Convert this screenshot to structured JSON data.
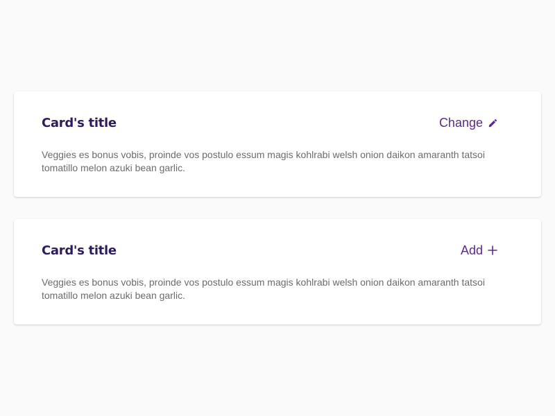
{
  "cards": [
    {
      "title": "Card's title",
      "action_label": "Change",
      "action_icon": "pencil-icon",
      "body": "Veggies es bonus vobis, proinde vos postulo essum magis kohlrabi welsh onion daikon amaranth tatsoi tomatillo melon azuki bean garlic."
    },
    {
      "title": "Card's title",
      "action_label": "Add",
      "action_icon": "plus-icon",
      "body": "Veggies es bonus vobis, proinde vos postulo essum magis kohlrabi welsh onion daikon amaranth tatsoi tomatillo melon azuki bean garlic."
    }
  ],
  "colors": {
    "page_background": "#fafafa",
    "card_background": "#ffffff",
    "title": "#2d1b5c",
    "action": "#5b2a8c",
    "body_text": "#6b6b6b"
  }
}
